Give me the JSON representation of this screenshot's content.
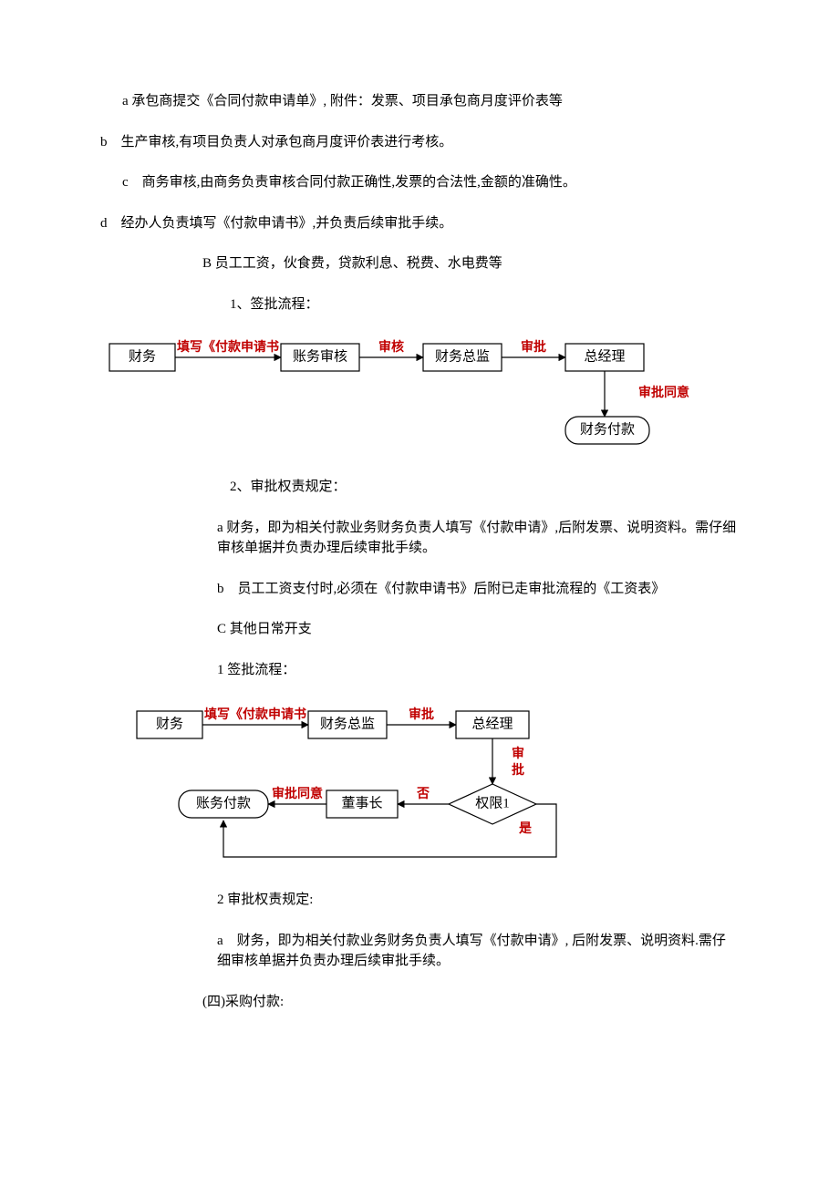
{
  "paragraphs": {
    "a": "a  承包商提交《合同付款申请单》, 附件：发票、项目承包商月度评价表等",
    "b": "b　生产审核,有项目负责人对承包商月度评价表进行考核。",
    "c": "c　商务审核,由商务负责审核合同付款正确性,发票的合法性,金额的准确性。",
    "d": "d　经办人负责填写《付款申请书》,并负责后续审批手续。",
    "B": "B  员工工资，伙食费，贷款利息、税费、水电费等",
    "B1": "1、签批流程：",
    "B2": "2、审批权责规定：",
    "Ba": "a  财务，即为相关付款业务财务负责人填写《付款申请》,后附发票、说明资料。需仔细审核单据并负责办理后续审批手续。",
    "Bb": "b　员工工资支付时,必须在《付款申请书》后附已走审批流程的《工资表》",
    "C": "C  其他日常开支",
    "C1": "1  签批流程：",
    "C2": "2 审批权责规定:",
    "Ca": "a　财务，即为相关付款业务财务负责人填写《付款申请》, 后附发票、说明资料.需仔细审核单据并负责办理后续审批手续。",
    "four": "(四)采购付款:"
  },
  "flow1": {
    "box1": "财务",
    "arr1": "填写《付款申请书",
    "box2": "账务审核",
    "arr2": "审核",
    "box3": "财务总监",
    "arr3": "审批",
    "box4": "总经理",
    "arr4": "审批同意",
    "box5": "财务付款"
  },
  "flow2": {
    "box1": "财务",
    "arr1": "填写《付款申请书",
    "box2": "财务总监",
    "arr2": "审批",
    "box3": "总经理",
    "arr3a": "审",
    "arr3b": "批",
    "diamond": "权限1",
    "yes": "是",
    "no": "否",
    "box4": "董事长",
    "arr5": "审批同意",
    "box5": "账务付款"
  }
}
